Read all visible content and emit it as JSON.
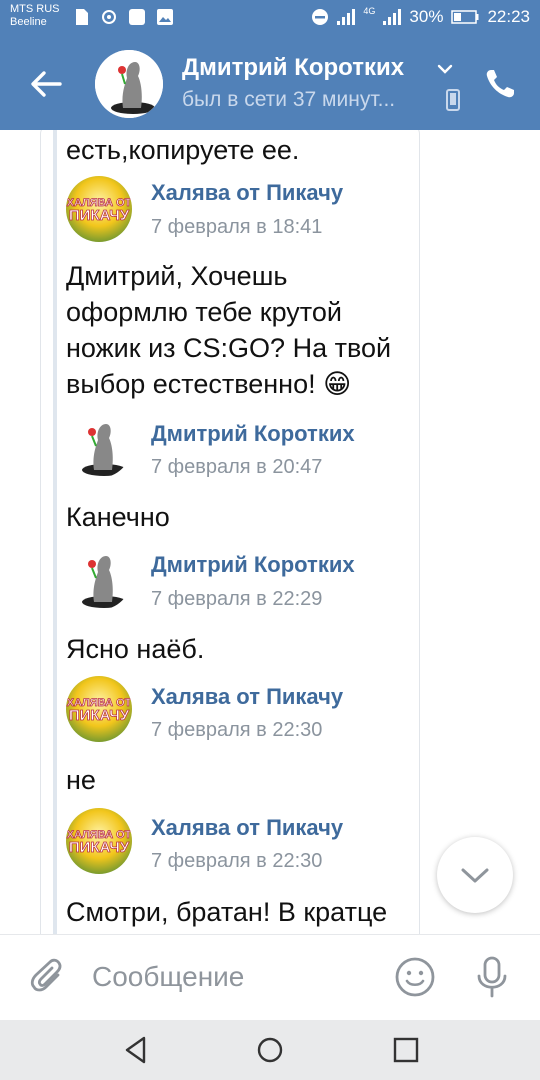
{
  "status": {
    "carrier1": "MTS RUS",
    "carrier2": "Beeline",
    "network": "4G",
    "battery": "30%",
    "time": "22:23"
  },
  "header": {
    "name": "Дмитрий Коротких",
    "status": "был в сети 37 минут..."
  },
  "messages": {
    "top_text": "есть,копируете ее.",
    "m1": {
      "author": "Халява от Пикачу",
      "time": "7 февраля в 18:41",
      "text": "Дмитрий, Хочешь оформлю тебе крутой ножик из CS:GO? На твой выбор естественно! 😁"
    },
    "m2": {
      "author": "Дмитрий Коротких",
      "time": "7 февраля в 20:47",
      "text": "Канечно"
    },
    "m3": {
      "author": "Дмитрий Коротких",
      "time": "7 февраля в 22:29",
      "text": "Ясно наёб."
    },
    "m4": {
      "author": "Халява от Пикачу",
      "time": "7 февраля в 22:30",
      "text": "не"
    },
    "m5": {
      "author": "Халява от Пикачу",
      "time": "7 февраля в 22:30",
      "text": "Смотри, братан! В кратце"
    },
    "pikachu_logo_line1": "ХАЛЯВА ОТ",
    "pikachu_logo_line2": "ПИКАЧУ"
  },
  "composer": {
    "placeholder": "Сообщение"
  },
  "colors": {
    "header_bg": "#5181b8",
    "author": "#3e6a9c",
    "time": "#8b949e"
  },
  "icons": [
    "back-arrow-icon",
    "chevron-down-icon",
    "phone-icon",
    "attach-icon",
    "emoji-icon",
    "mic-icon",
    "chevron-down-icon",
    "nav-back-icon",
    "nav-home-icon",
    "nav-recent-icon"
  ]
}
